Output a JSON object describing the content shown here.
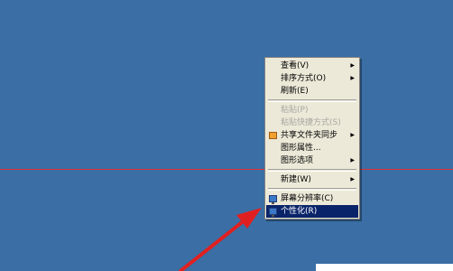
{
  "desktop": {
    "background_color": "#3a6ea5"
  },
  "context_menu": {
    "items": [
      {
        "label": "查看(V)",
        "submenu": true,
        "enabled": true
      },
      {
        "label": "排序方式(O)",
        "submenu": true,
        "enabled": true
      },
      {
        "label": "刷新(E)",
        "submenu": false,
        "enabled": true
      },
      {
        "label": "粘贴(P)",
        "submenu": false,
        "enabled": false
      },
      {
        "label": "粘贴快捷方式(S)",
        "submenu": false,
        "enabled": false
      },
      {
        "label": "共享文件夹同步",
        "submenu": true,
        "enabled": true,
        "icon": "sync-icon"
      },
      {
        "label": "图形属性...",
        "submenu": false,
        "enabled": true
      },
      {
        "label": "图形选项",
        "submenu": true,
        "enabled": true
      },
      {
        "label": "新建(W)",
        "submenu": true,
        "enabled": true
      },
      {
        "label": "屏幕分辨率(C)",
        "submenu": false,
        "enabled": true,
        "icon": "resolution-icon"
      },
      {
        "label": "个性化(R)",
        "submenu": false,
        "enabled": true,
        "icon": "personalize-icon",
        "highlighted": true
      }
    ],
    "submenu_arrow_glyph": "▶"
  },
  "annotation": {
    "arrow_color": "#e02020",
    "guide_line_color": "#e03030"
  }
}
